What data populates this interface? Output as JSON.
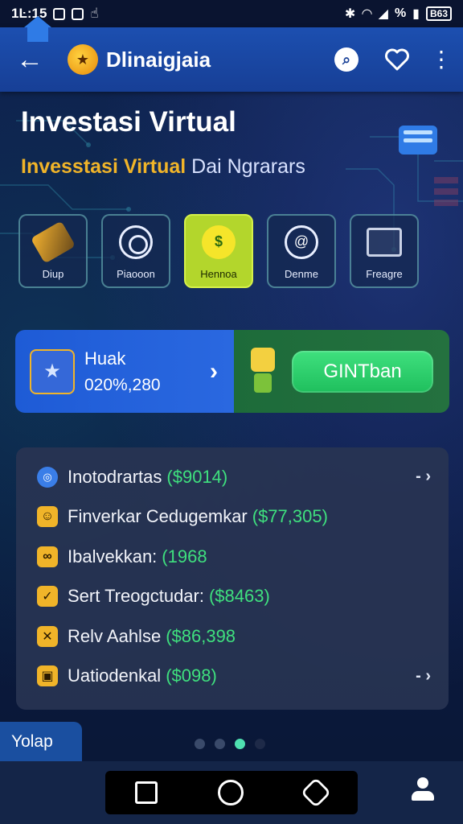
{
  "status_bar": {
    "time": "1Ŀ:15",
    "signal_text": "%",
    "battery_text": "B63"
  },
  "app_bar": {
    "title": "Dlinaigjaia",
    "logo_icon": "coin-logo-icon",
    "search_icon": "search-icon",
    "favorite_icon": "heart-icon",
    "menu_icon": "more-vert-icon"
  },
  "hero": {
    "title": "Investasi Virtual",
    "subtitle_highlight": "Invesstasi Virtual",
    "subtitle_rest": "Dai Ngrarars"
  },
  "categories": [
    {
      "label": "Diup",
      "icon": "package-icon"
    },
    {
      "label": "Piaooon",
      "icon": "target-icon"
    },
    {
      "label": "Hennoa",
      "icon": "dollar-coin-icon",
      "active": true
    },
    {
      "label": "Denme",
      "icon": "at-sign-icon"
    },
    {
      "label": "Freagre",
      "icon": "chart-icon"
    }
  ],
  "promo": {
    "title": "Huak",
    "amount": "020%,280",
    "cta_label": "GINTban"
  },
  "transactions": [
    {
      "label": "Inotodrartas",
      "value": "($9014)",
      "tail": "- ›",
      "icon": "globe-icon"
    },
    {
      "label": "Finverkar Cedugemkar",
      "value": "($77,305)",
      "tail": "",
      "icon": "person-icon"
    },
    {
      "label": "Ibalvekkan:",
      "value": "(1968",
      "tail": "",
      "icon": "link-icon"
    },
    {
      "label": "Sert Treogctudar:",
      "value": "($8463)",
      "tail": "",
      "icon": "check-icon"
    },
    {
      "label": "Relv Aahlse",
      "value": "($86,398",
      "tail": "",
      "icon": "cross-icon"
    },
    {
      "label": "Uatiodenkal",
      "value": "($098)",
      "tail": "- ›",
      "icon": "square-icon"
    }
  ],
  "footer": {
    "tag_label": "Yolap",
    "page_indicator": {
      "count": 4,
      "active_index": 2
    }
  },
  "colors": {
    "accent_blue": "#1c4fb0",
    "accent_green": "#3fe07e",
    "accent_gold": "#f0b429",
    "panel_bg": "#28344f"
  }
}
